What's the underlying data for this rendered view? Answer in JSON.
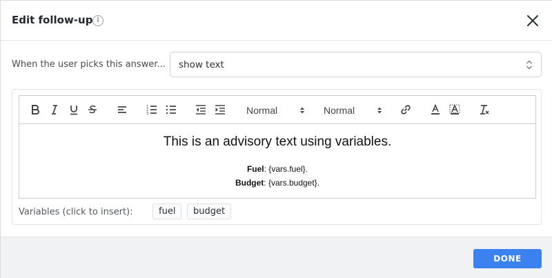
{
  "dialog": {
    "title": "Edit follow-up",
    "info_icon": "info-icon",
    "close_icon": "close-icon"
  },
  "answer": {
    "label": "When the user picks this answer...",
    "selected": "show text",
    "caret_icon": "updown-caret-icon"
  },
  "toolbar": {
    "buttons": [
      "bold-icon",
      "italic-icon",
      "underline-icon",
      "strikethrough-icon",
      "align-left-icon",
      "ordered-list-icon",
      "bullet-list-icon",
      "outdent-icon",
      "indent-icon",
      "link-icon",
      "text-color-icon",
      "background-color-icon",
      "clear-format-icon"
    ],
    "header_picker": "Normal",
    "size_picker": "Normal"
  },
  "content": {
    "heading": "This is an advisory text using variables.",
    "line1_label": "Fuel",
    "line1_value": ": {vars.fuel}.",
    "line2_label": "Budget",
    "line2_value": ": {vars.budget}."
  },
  "variables": {
    "label": "Variables (click to insert):",
    "chips": [
      "fuel",
      "budget"
    ]
  },
  "footer": {
    "done_label": "DONE"
  },
  "colors": {
    "accent": "#3b82f0",
    "background": "#f1f2f4"
  }
}
